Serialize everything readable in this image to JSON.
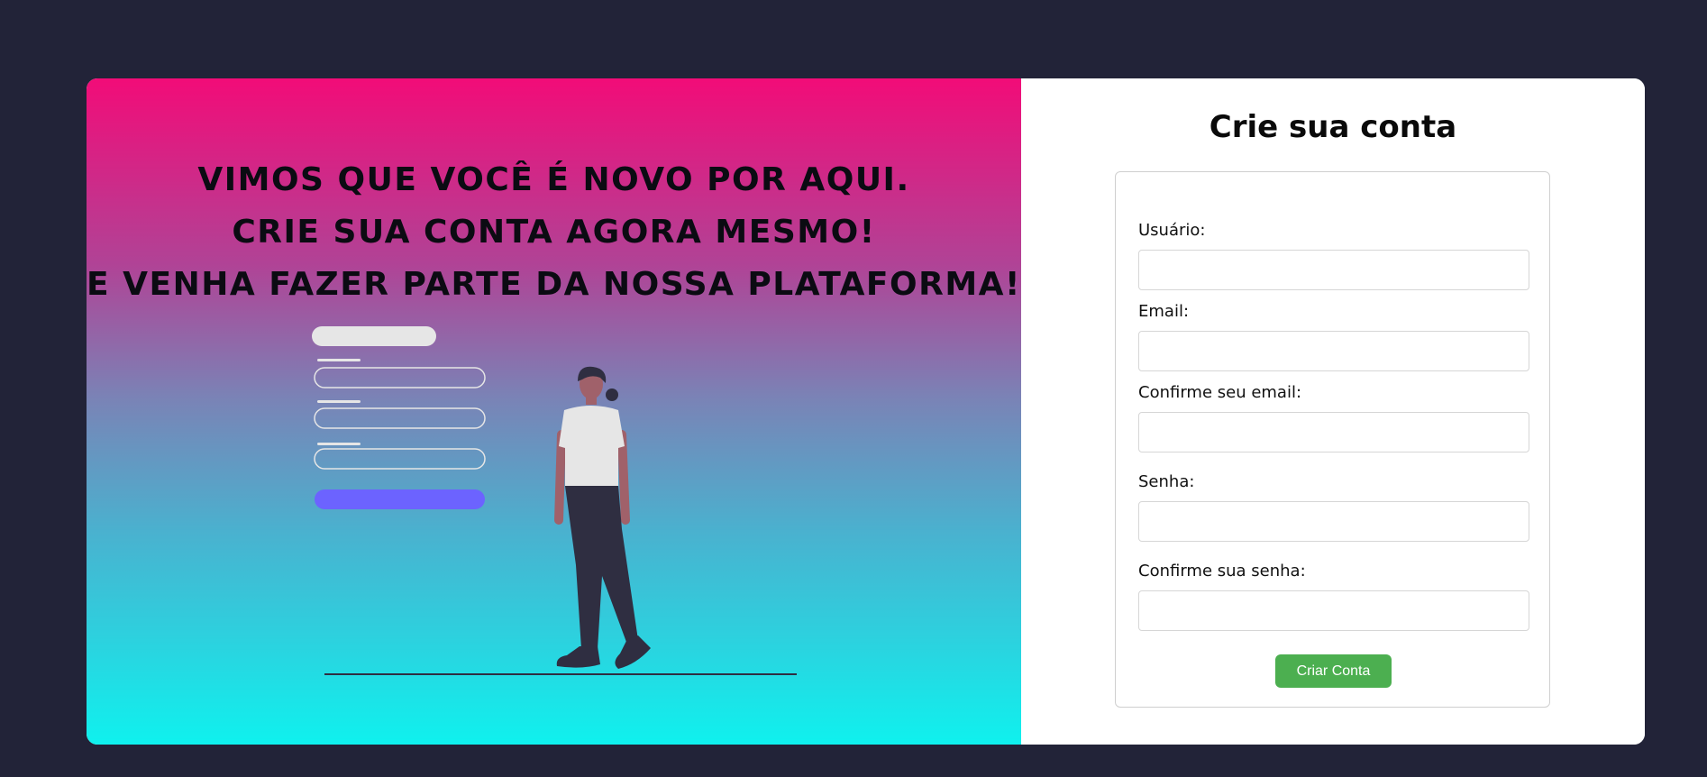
{
  "hero": {
    "lines": [
      "Vimos que você é novo por aqui.",
      "Crie sua conta agora mesmo!",
      "E venha fazer parte da nossa plataforma!"
    ]
  },
  "form": {
    "title": "Crie sua conta",
    "fields": [
      {
        "label": "Usuário:",
        "value": ""
      },
      {
        "label": "Email:",
        "value": ""
      },
      {
        "label": "Confirme seu email:",
        "value": ""
      },
      {
        "label": "Senha:",
        "value": ""
      },
      {
        "label": "Confirme sua senha:",
        "value": ""
      }
    ],
    "submit_label": "Criar Conta"
  },
  "colors": {
    "background": "#222338",
    "gradient_top": "#f20c78",
    "gradient_bottom": "#0ff1ee",
    "button": "#4caf50",
    "illustration_accent": "#6c63ff"
  }
}
